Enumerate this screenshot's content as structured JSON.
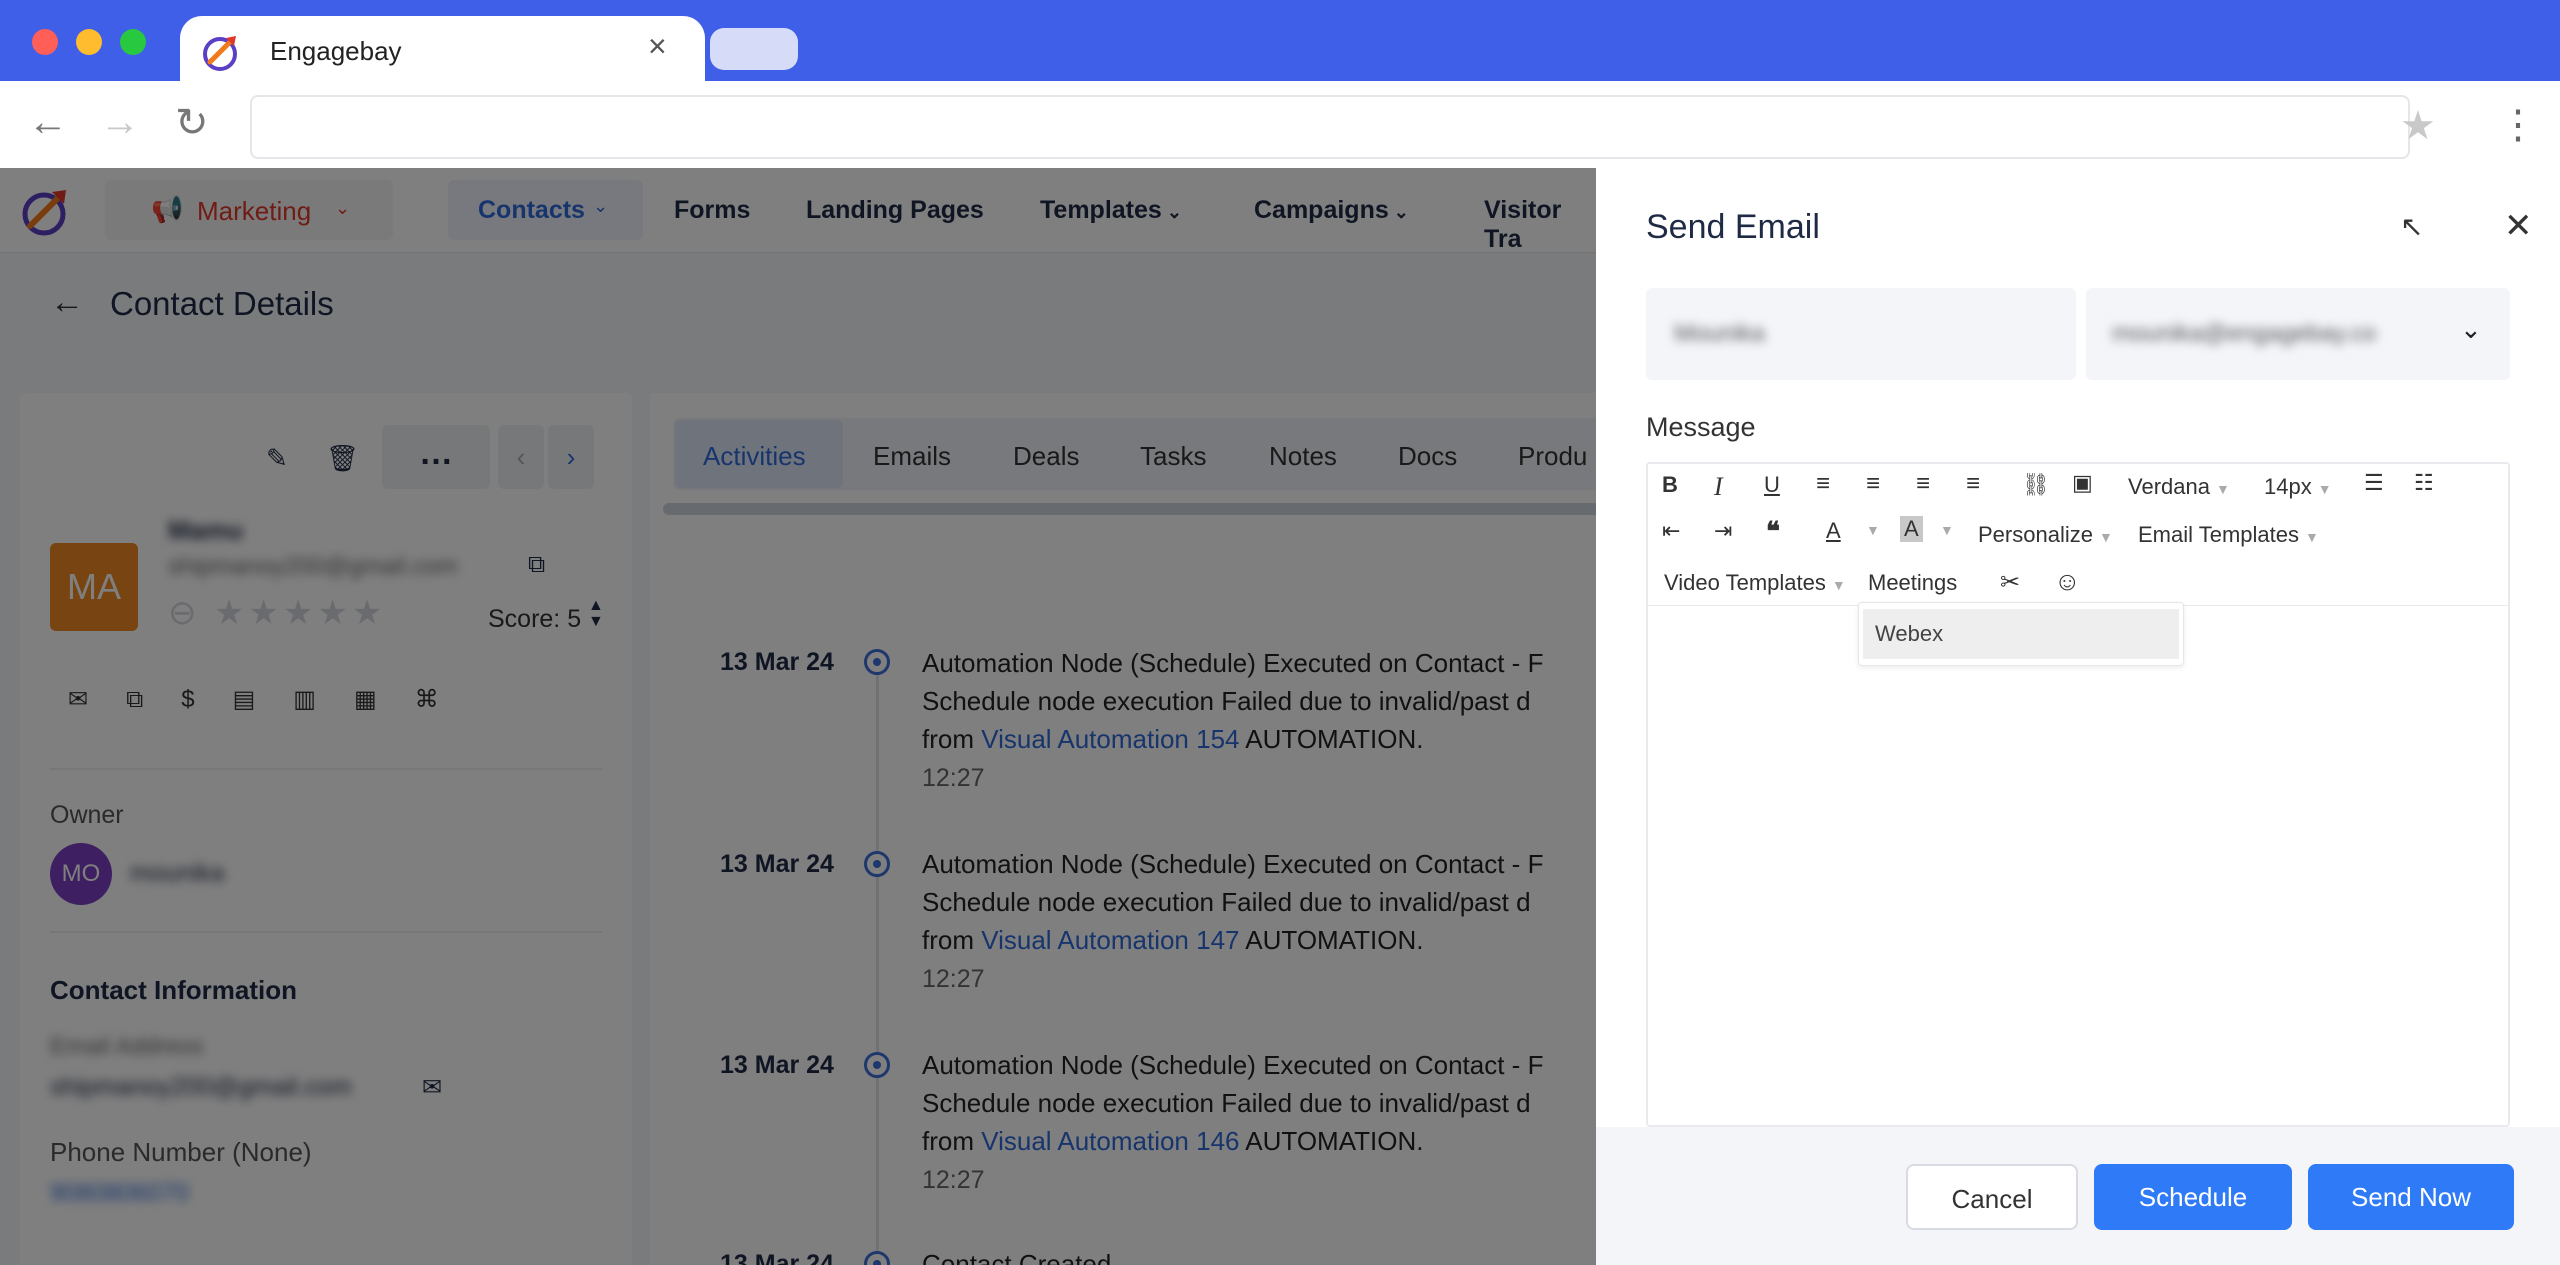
{
  "browser": {
    "tab_title": "Engagebay",
    "tab_close": "×",
    "back_icon": "←",
    "forward_icon": "→",
    "reload_icon": "↻",
    "star_icon": "★",
    "menu_icon": "⋮"
  },
  "topnav": {
    "marketing": "Marketing",
    "contacts": "Contacts",
    "forms": "Forms",
    "landing_pages": "Landing Pages",
    "templates": "Templates",
    "campaigns": "Campaigns",
    "visitor": "Visitor Tra"
  },
  "page": {
    "title": "Contact Details",
    "back_icon": "←"
  },
  "contact": {
    "initials": "MA",
    "name": "Mamu",
    "email": "shipmanoy200@gmail.com",
    "score_label": "Score: 5",
    "owner_label": "Owner",
    "owner_initials": "MO",
    "owner_name": "mounika",
    "contact_info_heading": "Contact Information",
    "email_label": "Email Address",
    "email_value": "shipmanoy200@gmail.com",
    "phone_label": "Phone Number (None)",
    "phone_value": "9080806070"
  },
  "tabs": [
    "Activities",
    "Emails",
    "Deals",
    "Tasks",
    "Notes",
    "Docs",
    "Produ"
  ],
  "timeline": [
    {
      "date": "13 Mar 24",
      "line1": "Automation Node (Schedule) Executed on Contact - F",
      "line2": "Schedule node execution Failed due to invalid/past d",
      "from": "from",
      "link": "Visual Automation 154",
      "suffix": "AUTOMATION.",
      "time": "12:27"
    },
    {
      "date": "13 Mar 24",
      "line1": "Automation Node (Schedule) Executed on Contact - F",
      "line2": "Schedule node execution Failed due to invalid/past d",
      "from": "from",
      "link": "Visual Automation 147",
      "suffix": "AUTOMATION.",
      "time": "12:27"
    },
    {
      "date": "13 Mar 24",
      "line1": "Automation Node (Schedule) Executed on Contact - F",
      "line2": "Schedule node execution Failed due to invalid/past d",
      "from": "from",
      "link": "Visual Automation 146",
      "suffix": "AUTOMATION.",
      "time": "12:27"
    },
    {
      "date": "13 Mar 24",
      "line1": "Contact Created",
      "line2": "",
      "from": "",
      "link": "",
      "suffix": "",
      "time": ""
    }
  ],
  "drawer": {
    "title": "Send Email",
    "expand_icon": "↖",
    "close_icon": "✕",
    "from_name": "Mounika",
    "from_email": "mounika@engagebay.co",
    "message_label": "Message",
    "font_family": "Verdana",
    "font_size": "14px",
    "personalize": "Personalize",
    "email_templates": "Email Templates",
    "video_templates": "Video Templates",
    "meetings": "Meetings",
    "meetings_option": "Webex",
    "cancel": "Cancel",
    "schedule": "Schedule",
    "send_now": "Send Now"
  },
  "colors": {
    "browser_blue": "#3f5fe8",
    "primary_button": "#2f7af7",
    "marketing_red": "#e0382b",
    "avatar_orange": "#f08a24",
    "owner_purple": "#7b3fc4",
    "link_blue": "#2f6ad9"
  }
}
